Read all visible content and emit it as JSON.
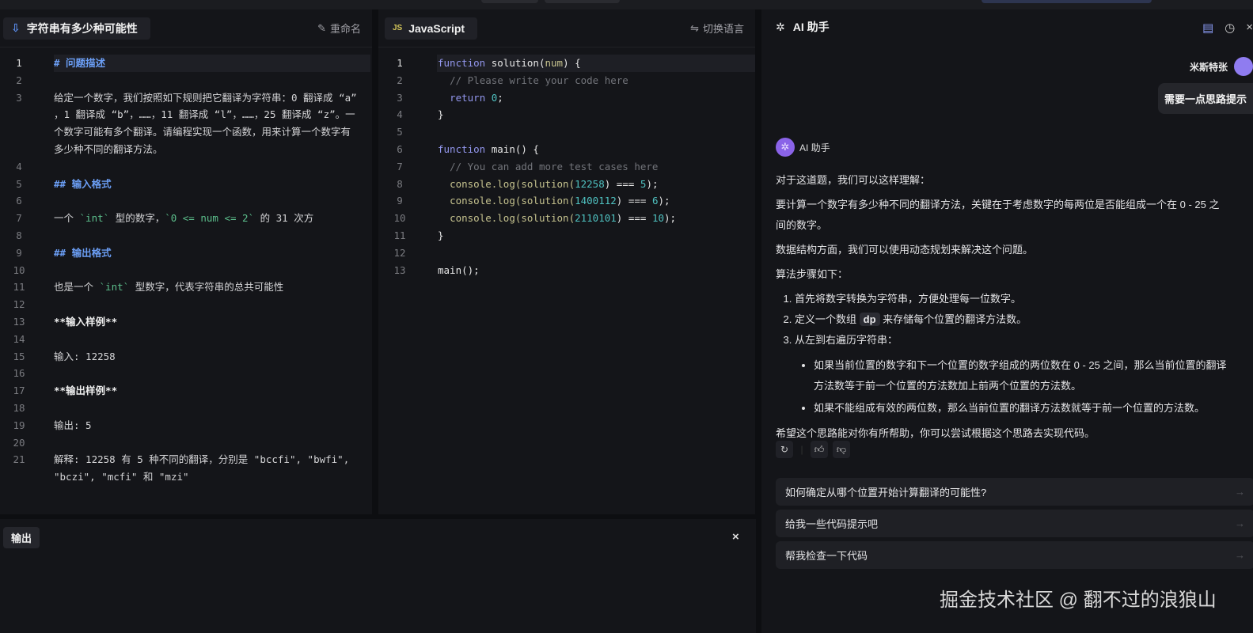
{
  "problem": {
    "title": "字符串有多少种可能性",
    "rename": "重命名",
    "lines": [
      [
        [
          "# 问题描述",
          "h"
        ]
      ],
      [],
      [
        [
          "给定一个数字，我们按照如下规则把它翻译为字符串：0 翻译成 “a” ，1 翻译成 “b”，……，11 翻译成 “l”，……，25 翻译成 “z”。一个数字可能有多个翻译。请编程实现一个函数，用来计算一个数字有多少种不同的翻译方法。",
          ""
        ]
      ],
      [],
      [
        [
          "## 输入格式",
          "h"
        ]
      ],
      [],
      [
        [
          "一个 ",
          ""
        ],
        [
          "`int`",
          "c"
        ],
        [
          " 型的数字，",
          ""
        ],
        [
          "`0 <= num <= 2`",
          "c"
        ],
        [
          " 的 31 次方",
          ""
        ]
      ],
      [],
      [
        [
          "## 输出格式",
          "h"
        ]
      ],
      [],
      [
        [
          "也是一个 ",
          ""
        ],
        [
          "`int`",
          "c"
        ],
        [
          " 型数字，代表字符串的总共可能性",
          ""
        ]
      ],
      [],
      [
        [
          "**输入样例**",
          "b"
        ]
      ],
      [],
      [
        [
          "输入: 12258",
          ""
        ]
      ],
      [],
      [
        [
          "**输出样例**",
          "b"
        ]
      ],
      [],
      [
        [
          "输出: 5",
          ""
        ]
      ],
      [],
      [
        [
          "解释: 12258 有 5 种不同的翻译，分别是 \"bccfi\", \"bwfi\", \"bczi\", \"mcfi\" 和 \"mzi\"",
          ""
        ]
      ]
    ]
  },
  "editor": {
    "language": "JavaScript",
    "lang_badge": "JS",
    "switch_language": "切换语言",
    "lines": [
      [
        [
          "function",
          "kw"
        ],
        [
          " solution(",
          "fn"
        ],
        [
          "num",
          "p"
        ],
        [
          ") {",
          "fn"
        ]
      ],
      [
        [
          "  // Please write your code here",
          "cm"
        ]
      ],
      [
        [
          "  return ",
          "kw"
        ],
        [
          "0",
          "n"
        ],
        [
          ";",
          "fn"
        ]
      ],
      [
        [
          "}",
          "fn"
        ]
      ],
      [],
      [
        [
          "function",
          "kw"
        ],
        [
          " main() {",
          "fn"
        ]
      ],
      [
        [
          "  // You can add more test cases here",
          "cm"
        ]
      ],
      [
        [
          "  console.log(solution(",
          "p"
        ],
        [
          "12258",
          "n"
        ],
        [
          ") === ",
          "fn"
        ],
        [
          "5",
          "n"
        ],
        [
          ");",
          "fn"
        ]
      ],
      [
        [
          "  console.log(solution(",
          "p"
        ],
        [
          "1400112",
          "n"
        ],
        [
          ") === ",
          "fn"
        ],
        [
          "6",
          "n"
        ],
        [
          ");",
          "fn"
        ]
      ],
      [
        [
          "  console.log(solution(",
          "p"
        ],
        [
          "2110101",
          "n"
        ],
        [
          ") === ",
          "fn"
        ],
        [
          "10",
          "n"
        ],
        [
          ");",
          "fn"
        ]
      ],
      [
        [
          "}",
          "fn"
        ]
      ],
      [],
      [
        [
          "main();",
          "fn"
        ]
      ]
    ]
  },
  "output": {
    "tab": "输出"
  },
  "ai": {
    "title": "AI 助手",
    "user_name": "米斯特张",
    "user_message": "需要一点思路提示",
    "bot_name": "AI 助手",
    "p1": "对于这道题，我们可以这样理解：",
    "p2": "要计算一个数字有多少种不同的翻译方法，关键在于考虑数字的每两位是否能组成一个在 0 - 25 之间的数字。",
    "p3": "数据结构方面，我们可以使用动态规划来解决这个问题。",
    "p4": "算法步骤如下：",
    "step1": "首先将数字转换为字符串，方便处理每一位数字。",
    "step2_pre": "定义一个数组 ",
    "step2_code": "dp",
    "step2_post": " 来存储每个位置的翻译方法数。",
    "step3": "从左到右遍历字符串：",
    "bullet1": "如果当前位置的数字和下一个位置的数字组成的两位数在 0 - 25 之间，那么当前位置的翻译方法数等于前一个位置的方法数加上前两个位置的方法数。",
    "bullet2": "如果不能组成有效的两位数，那么当前位置的翻译方法数就等于前一个位置的方法数。",
    "closing": "希望这个思路能对你有所帮助，你可以尝试根据这个思路去实现代码。",
    "suggestions": [
      "如何确定从哪个位置开始计算翻译的可能性?",
      "给我一些代码提示吧",
      "帮我检查一下代码"
    ]
  },
  "watermark": "掘金技术社区 @ 翻不过的浪狼山"
}
